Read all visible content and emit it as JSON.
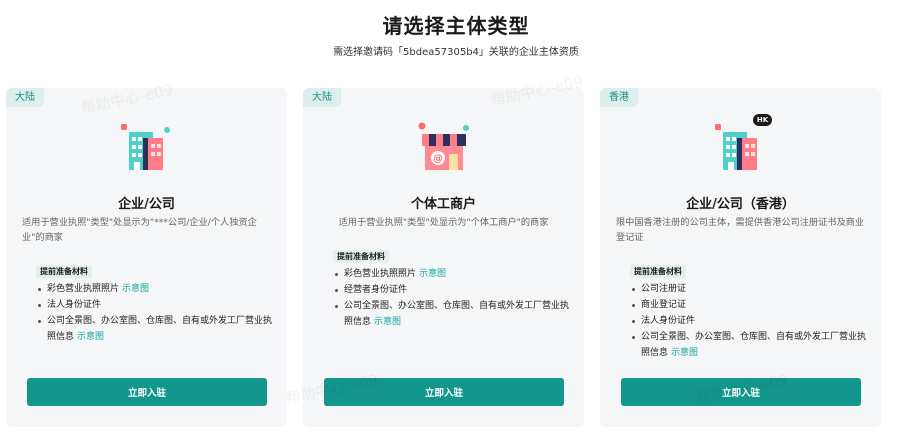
{
  "header": {
    "title": "请选择主体类型",
    "subtitle": "需选择邀请码「5bdea57305b4」关联的企业主体资质"
  },
  "watermark": "帮助中心-e09",
  "cards": [
    {
      "region": "大陆",
      "title": "企业/公司",
      "description": "适用于营业执照\"类型\"处显示为\"***公司/企业/个人独资企业\"的商家",
      "materials_label": "提前准备材料",
      "materials": [
        {
          "text": "彩色营业执照照片",
          "link": "示意图"
        },
        {
          "text": "法人身份证件",
          "link": ""
        },
        {
          "text": "公司全景图、办公室图、仓库图、自有或外发工厂营业执照信息",
          "link": "示意图"
        }
      ],
      "button": "立即入驻"
    },
    {
      "region": "大陆",
      "title": "个体工商户",
      "description": "适用于营业执照\"类型\"处显示为\"个体工商户\"的商家",
      "materials_label": "提前准备材料",
      "materials": [
        {
          "text": "彩色营业执照照片",
          "link": "示意图"
        },
        {
          "text": "经营者身份证件",
          "link": ""
        },
        {
          "text": "公司全景图、办公室图、仓库图、自有或外发工厂营业执照信息",
          "link": "示意图"
        }
      ],
      "button": "立即入驻"
    },
    {
      "region": "香港",
      "badge": "HK",
      "title": "企业/公司（香港）",
      "description": "限中国香港注册的公司主体，需提供香港公司注册证书及商业登记证",
      "materials_label": "提前准备材料",
      "materials": [
        {
          "text": "公司注册证",
          "link": ""
        },
        {
          "text": "商业登记证",
          "link": ""
        },
        {
          "text": "法人身份证件",
          "link": ""
        },
        {
          "text": "公司全景图、办公室图、仓库图、自有或外发工厂营业执照信息",
          "link": "示意图"
        }
      ],
      "button": "立即入驻"
    }
  ],
  "colors": {
    "accent": "#13968d",
    "link": "#13a89e",
    "tag_bg": "#dcefed"
  }
}
